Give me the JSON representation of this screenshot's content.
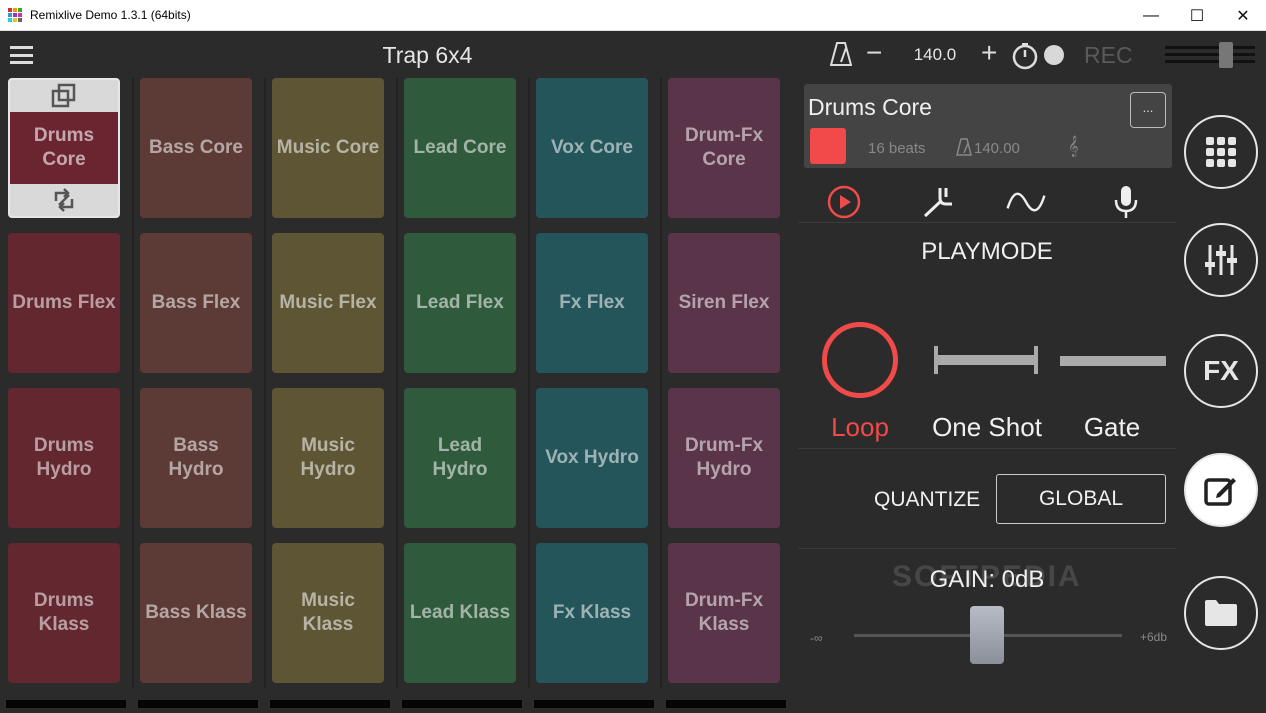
{
  "window": {
    "title": "Remixlive Demo 1.3.1 (64bits)",
    "min": "—",
    "max": "☐",
    "close": "✕"
  },
  "header": {
    "set_title": "Trap 6x4",
    "tempo_minus": "−",
    "tempo": "140.0",
    "tempo_plus": "+",
    "rec": "REC"
  },
  "pads": [
    {
      "row": 0,
      "col": 0,
      "label": "Drums Core",
      "color": "#6b2530",
      "selected": true
    },
    {
      "row": 0,
      "col": 1,
      "label": "Bass Core",
      "color": "#5c3a36"
    },
    {
      "row": 0,
      "col": 2,
      "label": "Music Core",
      "color": "#5e5535"
    },
    {
      "row": 0,
      "col": 3,
      "label": "Lead Core",
      "color": "#2f5a3c"
    },
    {
      "row": 0,
      "col": 4,
      "label": "Vox Core",
      "color": "#24555a"
    },
    {
      "row": 0,
      "col": 5,
      "label": "Drum-Fx Core",
      "color": "#5a3448"
    },
    {
      "row": 1,
      "col": 0,
      "label": "Drums Flex",
      "color": "#63272f"
    },
    {
      "row": 1,
      "col": 1,
      "label": "Bass Flex",
      "color": "#5c3a36"
    },
    {
      "row": 1,
      "col": 2,
      "label": "Music Flex",
      "color": "#5e5535"
    },
    {
      "row": 1,
      "col": 3,
      "label": "Lead Flex",
      "color": "#2f5a3c"
    },
    {
      "row": 1,
      "col": 4,
      "label": "Fx Flex",
      "color": "#24555a"
    },
    {
      "row": 1,
      "col": 5,
      "label": "Siren Flex",
      "color": "#5a3448"
    },
    {
      "row": 2,
      "col": 0,
      "label": "Drums Hydro",
      "color": "#63272f"
    },
    {
      "row": 2,
      "col": 1,
      "label": "Bass Hydro",
      "color": "#5c3a36"
    },
    {
      "row": 2,
      "col": 2,
      "label": "Music Hydro",
      "color": "#5e5535"
    },
    {
      "row": 2,
      "col": 3,
      "label": "Lead Hydro",
      "color": "#2f5a3c"
    },
    {
      "row": 2,
      "col": 4,
      "label": "Vox Hydro",
      "color": "#24555a"
    },
    {
      "row": 2,
      "col": 5,
      "label": "Drum-Fx Hydro",
      "color": "#5a3448"
    },
    {
      "row": 3,
      "col": 0,
      "label": "Drums Klass",
      "color": "#63272f"
    },
    {
      "row": 3,
      "col": 1,
      "label": "Bass Klass",
      "color": "#5c3a36"
    },
    {
      "row": 3,
      "col": 2,
      "label": "Music Klass",
      "color": "#5e5535"
    },
    {
      "row": 3,
      "col": 3,
      "label": "Lead Klass",
      "color": "#2f5a3c"
    },
    {
      "row": 3,
      "col": 4,
      "label": "Fx Klass",
      "color": "#24555a"
    },
    {
      "row": 3,
      "col": 5,
      "label": "Drum-Fx Klass",
      "color": "#5a3448"
    }
  ],
  "clip": {
    "name": "Drums Core",
    "more": "...",
    "beats": "16 beats",
    "bpm": "140.00",
    "key": "𝄞",
    "color": "#f24a4a"
  },
  "playmode": {
    "title": "PLAYMODE",
    "modes": [
      {
        "label": "Loop",
        "active": true
      },
      {
        "label": "One Shot",
        "active": false
      },
      {
        "label": "Gate",
        "active": false
      }
    ]
  },
  "quantize": {
    "label": "QUANTIZE",
    "value": "GLOBAL"
  },
  "gain": {
    "label": "GAIN: 0dB",
    "min": "-∞",
    "max": "+6db",
    "watermark": "SOFTPEDIA"
  },
  "sidebar": {
    "fx_label": "FX"
  },
  "colors": {
    "accent": "#f04a4a",
    "background": "#2b2b2b"
  }
}
